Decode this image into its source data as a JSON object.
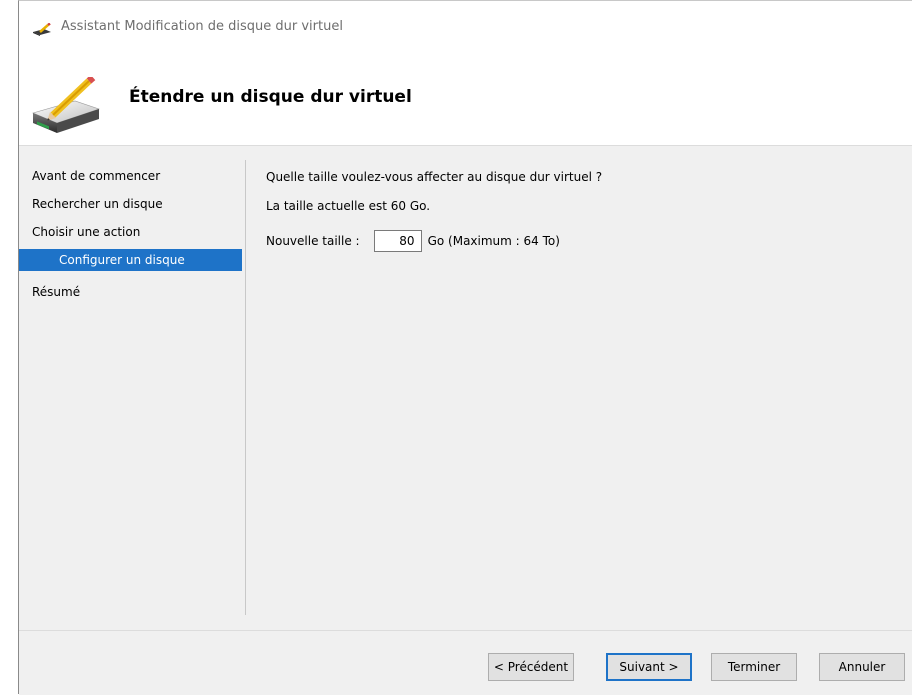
{
  "window": {
    "title": "Assistant Modification de disque dur virtuel"
  },
  "header": {
    "title": "Étendre un disque dur virtuel"
  },
  "sidebar": {
    "items": [
      {
        "label": "Avant de commencer"
      },
      {
        "label": "Rechercher un disque"
      },
      {
        "label": "Choisir une action"
      },
      {
        "label": "Configurer un disque",
        "selected": true
      },
      {
        "label": "Résumé"
      }
    ]
  },
  "main": {
    "question": "Quelle taille voulez-vous affecter au disque dur virtuel ?",
    "current_size": "La taille actuelle est 60 Go.",
    "new_size_label": "Nouvelle taille :",
    "new_size_value": "80",
    "new_size_unit": "Go (Maximum : 64 To)"
  },
  "buttons": {
    "previous": "< Précédent",
    "next": "Suivant >",
    "finish": "Terminer",
    "cancel": "Annuler"
  },
  "colors": {
    "selection": "#1e73c8",
    "content_bg": "#f0f0f0"
  },
  "icons": {
    "title": "disk-pencil-icon",
    "header": "disk-pencil-large-icon"
  }
}
